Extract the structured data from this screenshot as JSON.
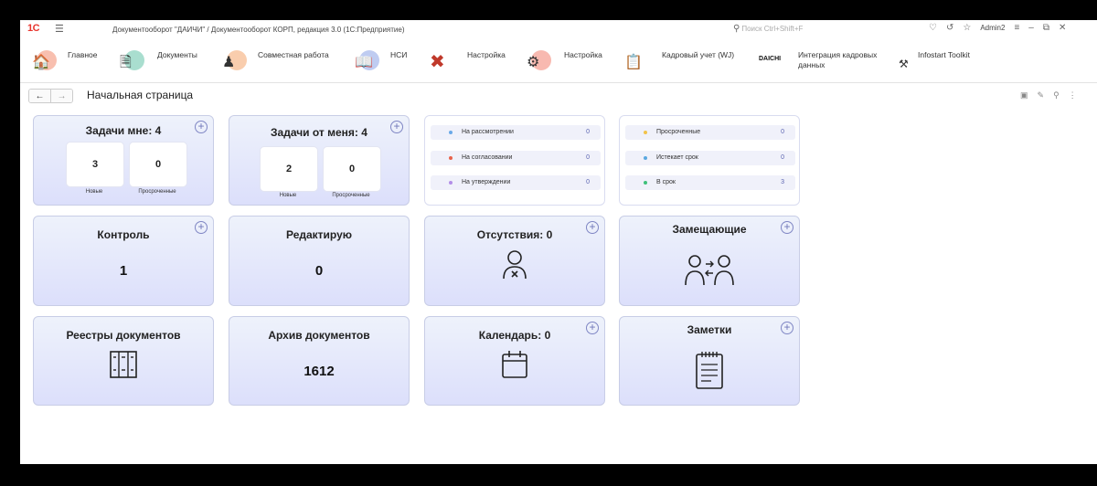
{
  "window": {
    "title": "Документооборот \"ДАИЧИ\" / Документооборот КОРП, редакция 3.0  (1С:Предприятие)",
    "search_placeholder": "Поиск Ctrl+Shift+F",
    "user": "Admin2",
    "logo": "1С"
  },
  "sections": [
    {
      "label": "Главное",
      "icon": "home-icon",
      "color": "#f28b6e"
    },
    {
      "label": "Документы",
      "icon": "documents-icon",
      "color": "#63c3a8"
    },
    {
      "label": "Совместная работа",
      "icon": "team-icon",
      "color": "#f4a46a"
    },
    {
      "label": "НСИ",
      "icon": "reference-icon",
      "color": "#8aa3e6"
    },
    {
      "label": "Настройка",
      "icon": "tools-icon",
      "color": "#ffffff"
    },
    {
      "label": "Настройка",
      "icon": "gear-icon",
      "color": "#f27f6f"
    },
    {
      "label": "Кадровый учет (WJ)",
      "icon": "hr-icon",
      "color": "#ffffff"
    },
    {
      "label": "Интеграция кадровых данных",
      "icon": "daichi-logo",
      "logo_text": "DAICHI",
      "color": "#ffffff"
    },
    {
      "label": "Infostart Toolkit",
      "icon": "toolkit-icon",
      "color": "#ffffff"
    }
  ],
  "page": {
    "title": "Начальная страница",
    "back": "←",
    "forward": "→"
  },
  "tiles": {
    "my_tasks": {
      "title": "Задачи мне: 4",
      "new_value": "3",
      "new_label": "Новые",
      "overdue_value": "0",
      "overdue_label": "Просроченные"
    },
    "from_me": {
      "title": "Задачи от меня: 4",
      "new_value": "2",
      "new_label": "Новые",
      "overdue_value": "0",
      "overdue_label": "Просроченные"
    },
    "status_list": [
      {
        "label": "На рассмотрении",
        "value": "0",
        "color": "#6aa9e8"
      },
      {
        "label": "На согласовании",
        "value": "0",
        "color": "#e8624a"
      },
      {
        "label": "На утверждении",
        "value": "0",
        "color": "#b38ee8"
      }
    ],
    "deadline_list": [
      {
        "label": "Просроченные",
        "value": "0",
        "color": "#f2c34a"
      },
      {
        "label": "Истекает срок",
        "value": "0",
        "color": "#5aa8e0"
      },
      {
        "label": "В срок",
        "value": "3",
        "color": "#3fc07a"
      }
    ],
    "control": {
      "title": "Контроль",
      "value": "1"
    },
    "editing": {
      "title": "Редактирую",
      "value": "0"
    },
    "absences": {
      "title": "Отсутствия: 0"
    },
    "substitutes": {
      "title": "Замещающие"
    },
    "registers": {
      "title": "Реестры документов"
    },
    "archive": {
      "title": "Архив документов",
      "value": "1612"
    },
    "calendar": {
      "title": "Календарь: 0"
    },
    "notes": {
      "title": "Заметки"
    }
  }
}
